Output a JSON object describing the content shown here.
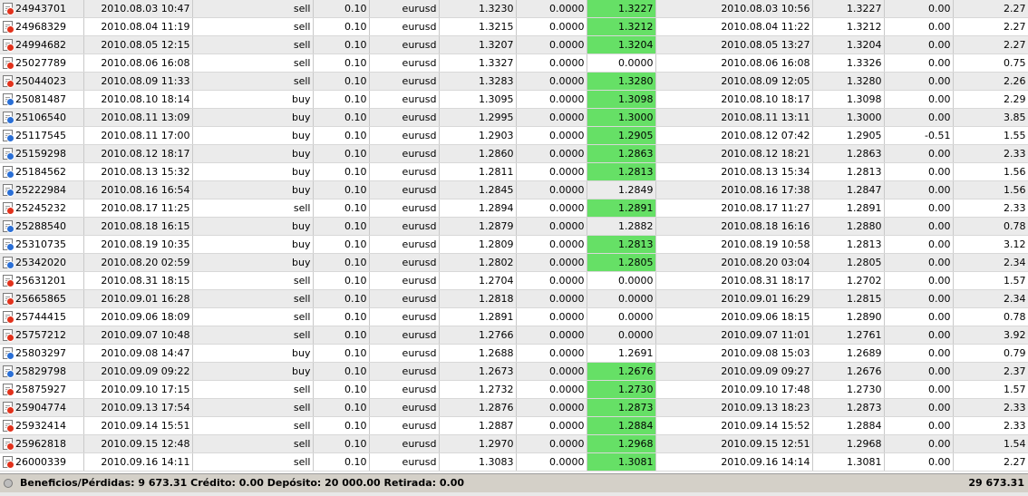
{
  "trades": [
    {
      "ticket": "24943701",
      "open_time": "2010.08.03 10:47",
      "type": "sell",
      "size": "0.10",
      "item": "eurusd",
      "price": "1.3230",
      "sl": "0.0000",
      "tp": "1.3227",
      "tp_hit": true,
      "close_time": "2010.08.03 10:56",
      "close_price": "1.3227",
      "swap": "0.00",
      "profit": "2.27"
    },
    {
      "ticket": "24968329",
      "open_time": "2010.08.04 11:19",
      "type": "sell",
      "size": "0.10",
      "item": "eurusd",
      "price": "1.3215",
      "sl": "0.0000",
      "tp": "1.3212",
      "tp_hit": true,
      "close_time": "2010.08.04 11:22",
      "close_price": "1.3212",
      "swap": "0.00",
      "profit": "2.27"
    },
    {
      "ticket": "24994682",
      "open_time": "2010.08.05 12:15",
      "type": "sell",
      "size": "0.10",
      "item": "eurusd",
      "price": "1.3207",
      "sl": "0.0000",
      "tp": "1.3204",
      "tp_hit": true,
      "close_time": "2010.08.05 13:27",
      "close_price": "1.3204",
      "swap": "0.00",
      "profit": "2.27"
    },
    {
      "ticket": "25027789",
      "open_time": "2010.08.06 16:08",
      "type": "sell",
      "size": "0.10",
      "item": "eurusd",
      "price": "1.3327",
      "sl": "0.0000",
      "tp": "0.0000",
      "tp_hit": false,
      "close_time": "2010.08.06 16:08",
      "close_price": "1.3326",
      "swap": "0.00",
      "profit": "0.75"
    },
    {
      "ticket": "25044023",
      "open_time": "2010.08.09 11:33",
      "type": "sell",
      "size": "0.10",
      "item": "eurusd",
      "price": "1.3283",
      "sl": "0.0000",
      "tp": "1.3280",
      "tp_hit": true,
      "close_time": "2010.08.09 12:05",
      "close_price": "1.3280",
      "swap": "0.00",
      "profit": "2.26"
    },
    {
      "ticket": "25081487",
      "open_time": "2010.08.10 18:14",
      "type": "buy",
      "size": "0.10",
      "item": "eurusd",
      "price": "1.3095",
      "sl": "0.0000",
      "tp": "1.3098",
      "tp_hit": true,
      "close_time": "2010.08.10 18:17",
      "close_price": "1.3098",
      "swap": "0.00",
      "profit": "2.29"
    },
    {
      "ticket": "25106540",
      "open_time": "2010.08.11 13:09",
      "type": "buy",
      "size": "0.10",
      "item": "eurusd",
      "price": "1.2995",
      "sl": "0.0000",
      "tp": "1.3000",
      "tp_hit": true,
      "close_time": "2010.08.11 13:11",
      "close_price": "1.3000",
      "swap": "0.00",
      "profit": "3.85"
    },
    {
      "ticket": "25117545",
      "open_time": "2010.08.11 17:00",
      "type": "buy",
      "size": "0.10",
      "item": "eurusd",
      "price": "1.2903",
      "sl": "0.0000",
      "tp": "1.2905",
      "tp_hit": true,
      "close_time": "2010.08.12 07:42",
      "close_price": "1.2905",
      "swap": "-0.51",
      "profit": "1.55"
    },
    {
      "ticket": "25159298",
      "open_time": "2010.08.12 18:17",
      "type": "buy",
      "size": "0.10",
      "item": "eurusd",
      "price": "1.2860",
      "sl": "0.0000",
      "tp": "1.2863",
      "tp_hit": true,
      "close_time": "2010.08.12 18:21",
      "close_price": "1.2863",
      "swap": "0.00",
      "profit": "2.33"
    },
    {
      "ticket": "25184562",
      "open_time": "2010.08.13 15:32",
      "type": "buy",
      "size": "0.10",
      "item": "eurusd",
      "price": "1.2811",
      "sl": "0.0000",
      "tp": "1.2813",
      "tp_hit": true,
      "close_time": "2010.08.13 15:34",
      "close_price": "1.2813",
      "swap": "0.00",
      "profit": "1.56"
    },
    {
      "ticket": "25222984",
      "open_time": "2010.08.16 16:54",
      "type": "buy",
      "size": "0.10",
      "item": "eurusd",
      "price": "1.2845",
      "sl": "0.0000",
      "tp": "1.2849",
      "tp_hit": false,
      "close_time": "2010.08.16 17:38",
      "close_price": "1.2847",
      "swap": "0.00",
      "profit": "1.56"
    },
    {
      "ticket": "25245232",
      "open_time": "2010.08.17 11:25",
      "type": "sell",
      "size": "0.10",
      "item": "eurusd",
      "price": "1.2894",
      "sl": "0.0000",
      "tp": "1.2891",
      "tp_hit": true,
      "close_time": "2010.08.17 11:27",
      "close_price": "1.2891",
      "swap": "0.00",
      "profit": "2.33"
    },
    {
      "ticket": "25288540",
      "open_time": "2010.08.18 16:15",
      "type": "buy",
      "size": "0.10",
      "item": "eurusd",
      "price": "1.2879",
      "sl": "0.0000",
      "tp": "1.2882",
      "tp_hit": false,
      "close_time": "2010.08.18 16:16",
      "close_price": "1.2880",
      "swap": "0.00",
      "profit": "0.78"
    },
    {
      "ticket": "25310735",
      "open_time": "2010.08.19 10:35",
      "type": "buy",
      "size": "0.10",
      "item": "eurusd",
      "price": "1.2809",
      "sl": "0.0000",
      "tp": "1.2813",
      "tp_hit": true,
      "close_time": "2010.08.19 10:58",
      "close_price": "1.2813",
      "swap": "0.00",
      "profit": "3.12"
    },
    {
      "ticket": "25342020",
      "open_time": "2010.08.20 02:59",
      "type": "buy",
      "size": "0.10",
      "item": "eurusd",
      "price": "1.2802",
      "sl": "0.0000",
      "tp": "1.2805",
      "tp_hit": true,
      "close_time": "2010.08.20 03:04",
      "close_price": "1.2805",
      "swap": "0.00",
      "profit": "2.34"
    },
    {
      "ticket": "25631201",
      "open_time": "2010.08.31 18:15",
      "type": "sell",
      "size": "0.10",
      "item": "eurusd",
      "price": "1.2704",
      "sl": "0.0000",
      "tp": "0.0000",
      "tp_hit": false,
      "close_time": "2010.08.31 18:17",
      "close_price": "1.2702",
      "swap": "0.00",
      "profit": "1.57"
    },
    {
      "ticket": "25665865",
      "open_time": "2010.09.01 16:28",
      "type": "sell",
      "size": "0.10",
      "item": "eurusd",
      "price": "1.2818",
      "sl": "0.0000",
      "tp": "0.0000",
      "tp_hit": false,
      "close_time": "2010.09.01 16:29",
      "close_price": "1.2815",
      "swap": "0.00",
      "profit": "2.34"
    },
    {
      "ticket": "25744415",
      "open_time": "2010.09.06 18:09",
      "type": "sell",
      "size": "0.10",
      "item": "eurusd",
      "price": "1.2891",
      "sl": "0.0000",
      "tp": "0.0000",
      "tp_hit": false,
      "close_time": "2010.09.06 18:15",
      "close_price": "1.2890",
      "swap": "0.00",
      "profit": "0.78"
    },
    {
      "ticket": "25757212",
      "open_time": "2010.09.07 10:48",
      "type": "sell",
      "size": "0.10",
      "item": "eurusd",
      "price": "1.2766",
      "sl": "0.0000",
      "tp": "0.0000",
      "tp_hit": false,
      "close_time": "2010.09.07 11:01",
      "close_price": "1.2761",
      "swap": "0.00",
      "profit": "3.92"
    },
    {
      "ticket": "25803297",
      "open_time": "2010.09.08 14:47",
      "type": "buy",
      "size": "0.10",
      "item": "eurusd",
      "price": "1.2688",
      "sl": "0.0000",
      "tp": "1.2691",
      "tp_hit": false,
      "close_time": "2010.09.08 15:03",
      "close_price": "1.2689",
      "swap": "0.00",
      "profit": "0.79"
    },
    {
      "ticket": "25829798",
      "open_time": "2010.09.09 09:22",
      "type": "buy",
      "size": "0.10",
      "item": "eurusd",
      "price": "1.2673",
      "sl": "0.0000",
      "tp": "1.2676",
      "tp_hit": true,
      "close_time": "2010.09.09 09:27",
      "close_price": "1.2676",
      "swap": "0.00",
      "profit": "2.37"
    },
    {
      "ticket": "25875927",
      "open_time": "2010.09.10 17:15",
      "type": "sell",
      "size": "0.10",
      "item": "eurusd",
      "price": "1.2732",
      "sl": "0.0000",
      "tp": "1.2730",
      "tp_hit": true,
      "close_time": "2010.09.10 17:48",
      "close_price": "1.2730",
      "swap": "0.00",
      "profit": "1.57"
    },
    {
      "ticket": "25904774",
      "open_time": "2010.09.13 17:54",
      "type": "sell",
      "size": "0.10",
      "item": "eurusd",
      "price": "1.2876",
      "sl": "0.0000",
      "tp": "1.2873",
      "tp_hit": true,
      "close_time": "2010.09.13 18:23",
      "close_price": "1.2873",
      "swap": "0.00",
      "profit": "2.33"
    },
    {
      "ticket": "25932414",
      "open_time": "2010.09.14 15:51",
      "type": "sell",
      "size": "0.10",
      "item": "eurusd",
      "price": "1.2887",
      "sl": "0.0000",
      "tp": "1.2884",
      "tp_hit": true,
      "close_time": "2010.09.14 15:52",
      "close_price": "1.2884",
      "swap": "0.00",
      "profit": "2.33"
    },
    {
      "ticket": "25962818",
      "open_time": "2010.09.15 12:48",
      "type": "sell",
      "size": "0.10",
      "item": "eurusd",
      "price": "1.2970",
      "sl": "0.0000",
      "tp": "1.2968",
      "tp_hit": true,
      "close_time": "2010.09.15 12:51",
      "close_price": "1.2968",
      "swap": "0.00",
      "profit": "1.54"
    },
    {
      "ticket": "26000339",
      "open_time": "2010.09.16 14:11",
      "type": "sell",
      "size": "0.10",
      "item": "eurusd",
      "price": "1.3083",
      "sl": "0.0000",
      "tp": "1.3081",
      "tp_hit": true,
      "close_time": "2010.09.16 14:14",
      "close_price": "1.3081",
      "swap": "0.00",
      "profit": "2.27"
    }
  ],
  "status_bar": {
    "summary": "Beneficios/Pérdidas: 9 673.31  Crédito: 0.00  Depósito: 20 000.00  Retirada: 0.00",
    "total": "29 673.31"
  },
  "colors": {
    "tp_highlight": "#66e066",
    "row_alt": "#ebebeb",
    "sell_icon": "#e2321c",
    "buy_icon": "#2a6fd6"
  }
}
